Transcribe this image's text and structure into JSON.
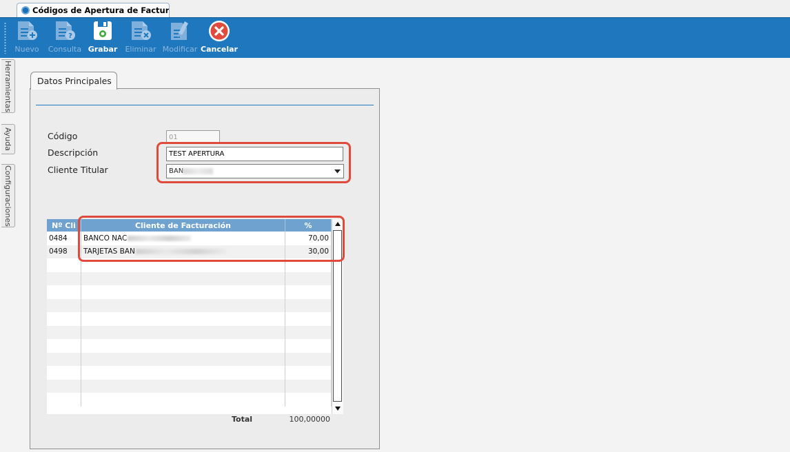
{
  "window": {
    "tab_title": "Códigos de Apertura de Facturaci..."
  },
  "toolbar": {
    "buttons": [
      {
        "id": "nuevo",
        "label": "Nuevo",
        "icon": "document-add-icon",
        "enabled": false
      },
      {
        "id": "consulta",
        "label": "Consulta",
        "icon": "document-query-icon",
        "enabled": false
      },
      {
        "id": "grabar",
        "label": "Grabar",
        "icon": "floppy-save-icon",
        "enabled": true
      },
      {
        "id": "eliminar",
        "label": "Eliminar",
        "icon": "document-delete-icon",
        "enabled": false
      },
      {
        "id": "modificar",
        "label": "Modificar",
        "icon": "document-edit-icon",
        "enabled": false
      },
      {
        "id": "cancelar",
        "label": "Cancelar",
        "icon": "cancel-circle-icon",
        "enabled": true
      }
    ]
  },
  "side_tabs": [
    "Herramientas",
    "Ayuda",
    "Configuraciones"
  ],
  "panel": {
    "tab_label": "Datos Principales",
    "codigo_label": "Código",
    "codigo_value": "01",
    "descripcion_label": "Descripción",
    "descripcion_value": "TEST APERTURA",
    "cliente_label": "Cliente Titular",
    "cliente_value": "BAN"
  },
  "grid": {
    "columns": [
      "Nº Cli",
      "Cliente de Facturación",
      "%"
    ],
    "rows": [
      {
        "num": "0484",
        "cliente": "BANCO NAC",
        "pct": "70,00"
      },
      {
        "num": "0498",
        "cliente": "TARJETAS BAN",
        "pct": "30,00"
      }
    ],
    "total_label": "Total",
    "total_value": "100,00000"
  },
  "colors": {
    "toolbar_bg": "#1f77bd",
    "highlight": "#e04a3d",
    "grid_header": "#6fa2cf"
  }
}
